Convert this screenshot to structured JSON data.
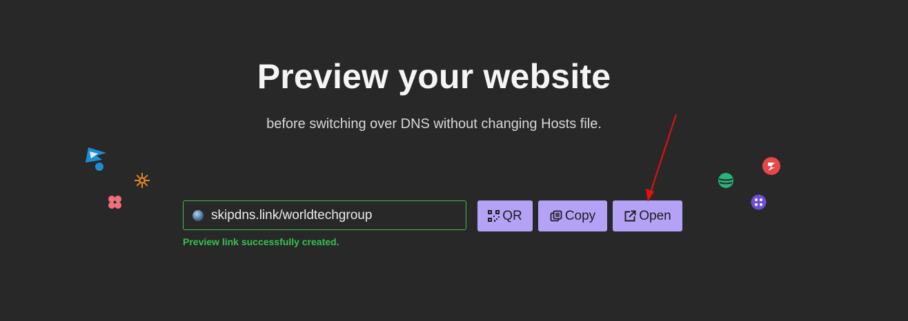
{
  "hero": {
    "title": "Preview your website",
    "subtitle": "before switching over DNS without changing Hosts file."
  },
  "preview_link": {
    "value": "skipdns.link/worldtechgroup",
    "favicon": "globe-favicon-icon",
    "status": "Preview link successfully created.",
    "status_color": "#34c24f",
    "border_color": "#3fbf4f"
  },
  "actions": {
    "qr_label": "QR",
    "qr_icon": "qr-code-icon",
    "copy_label": "Copy",
    "copy_icon": "copy-icon",
    "open_label": "Open",
    "open_icon": "external-link-icon",
    "button_color": "#b4a2f7"
  },
  "colors": {
    "background": "#282828",
    "annotation_arrow": "#e01010"
  },
  "decorations": [
    "blue-logo-icon",
    "orange-sun-icon",
    "pink-flower-icon",
    "green-ball-icon",
    "red-lightning-icon",
    "purple-dots-icon"
  ]
}
